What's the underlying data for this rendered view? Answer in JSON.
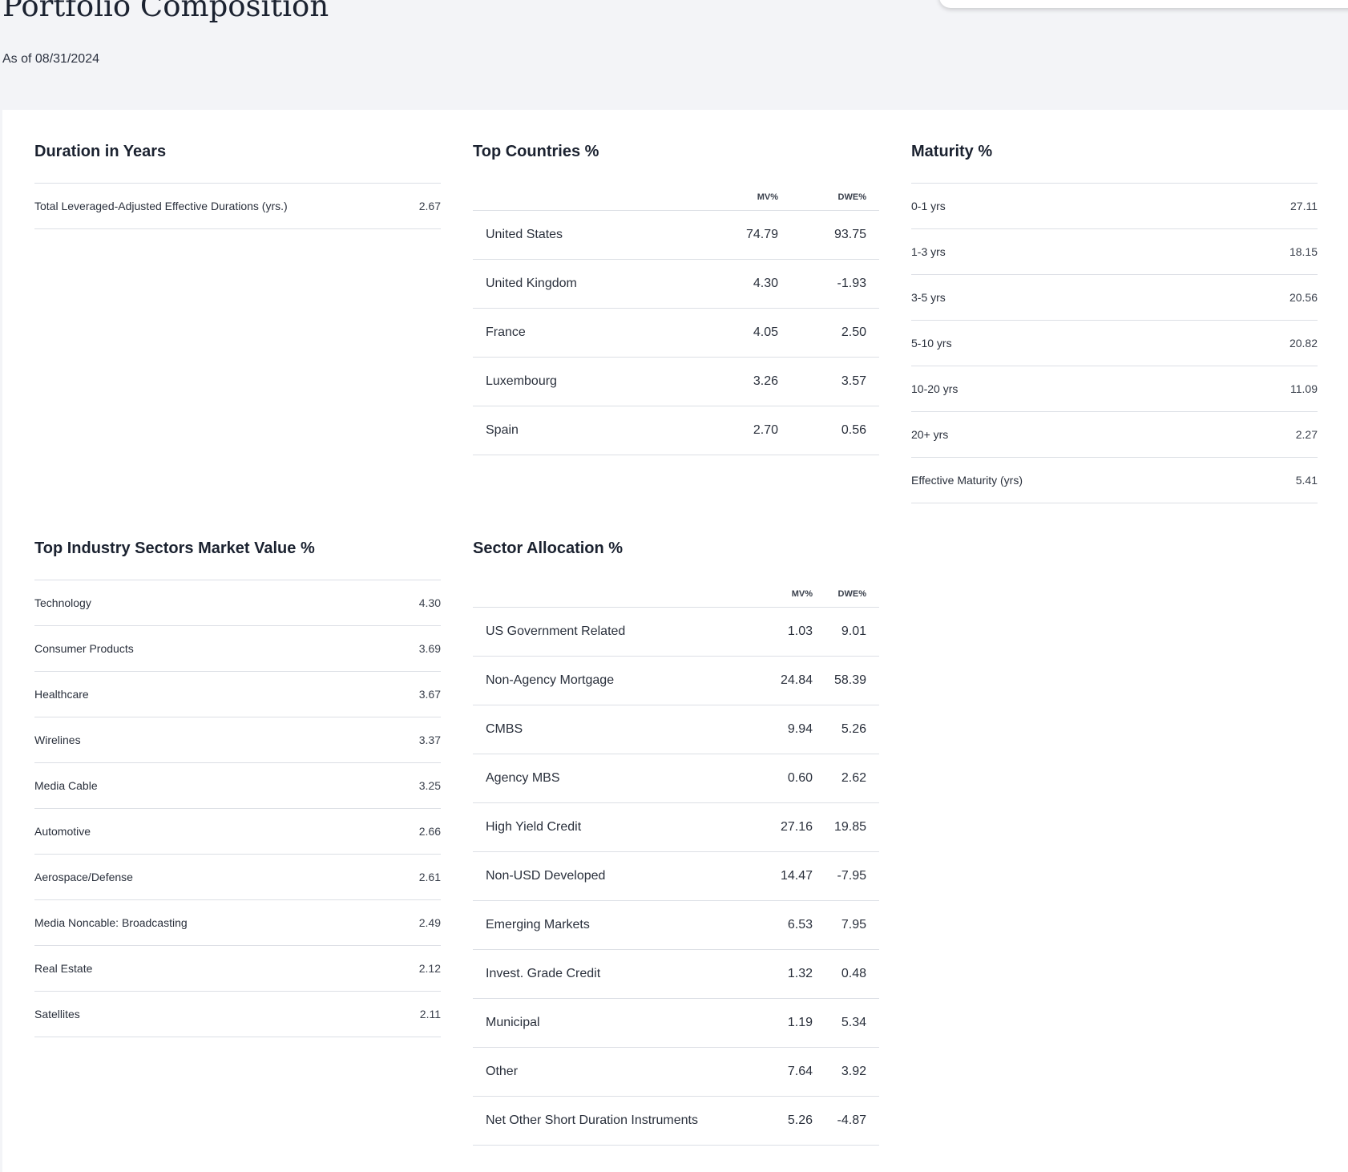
{
  "header": {
    "title": "Portfolio Composition",
    "as_of": "As of 08/31/2024"
  },
  "duration": {
    "title": "Duration in Years",
    "rows": [
      {
        "label": "Total Leveraged-Adjusted Effective Durations (yrs.)",
        "value": "2.67"
      }
    ]
  },
  "top_countries": {
    "title": "Top Countries %",
    "col_mv": "MV%",
    "col_dwe": "DWE%",
    "rows": [
      {
        "name": "United States",
        "mv": "74.79",
        "dwe": "93.75"
      },
      {
        "name": "United Kingdom",
        "mv": "4.30",
        "dwe": "-1.93"
      },
      {
        "name": "France",
        "mv": "4.05",
        "dwe": "2.50"
      },
      {
        "name": "Luxembourg",
        "mv": "3.26",
        "dwe": "3.57"
      },
      {
        "name": "Spain",
        "mv": "2.70",
        "dwe": "0.56"
      }
    ]
  },
  "maturity": {
    "title": "Maturity %",
    "rows": [
      {
        "label": "0-1 yrs",
        "value": "27.11"
      },
      {
        "label": "1-3 yrs",
        "value": "18.15"
      },
      {
        "label": "3-5 yrs",
        "value": "20.56"
      },
      {
        "label": "5-10 yrs",
        "value": "20.82"
      },
      {
        "label": "10-20 yrs",
        "value": "11.09"
      },
      {
        "label": "20+ yrs",
        "value": "2.27"
      },
      {
        "label": "Effective Maturity (yrs)",
        "value": "5.41"
      }
    ]
  },
  "industry_sectors": {
    "title": "Top Industry Sectors Market Value %",
    "rows": [
      {
        "label": "Technology",
        "value": "4.30"
      },
      {
        "label": "Consumer Products",
        "value": "3.69"
      },
      {
        "label": "Healthcare",
        "value": "3.67"
      },
      {
        "label": "Wirelines",
        "value": "3.37"
      },
      {
        "label": "Media Cable",
        "value": "3.25"
      },
      {
        "label": "Automotive",
        "value": "2.66"
      },
      {
        "label": "Aerospace/Defense",
        "value": "2.61"
      },
      {
        "label": "Media Noncable: Broadcasting",
        "value": "2.49"
      },
      {
        "label": "Real Estate",
        "value": "2.12"
      },
      {
        "label": "Satellites",
        "value": "2.11"
      }
    ]
  },
  "sector_allocation": {
    "title": "Sector Allocation %",
    "col_mv": "MV%",
    "col_dwe": "DWE%",
    "rows": [
      {
        "name": "US Government Related",
        "mv": "1.03",
        "dwe": "9.01"
      },
      {
        "name": "Non-Agency Mortgage",
        "mv": "24.84",
        "dwe": "58.39"
      },
      {
        "name": "CMBS",
        "mv": "9.94",
        "dwe": "5.26"
      },
      {
        "name": "Agency MBS",
        "mv": "0.60",
        "dwe": "2.62"
      },
      {
        "name": "High Yield Credit",
        "mv": "27.16",
        "dwe": "19.85"
      },
      {
        "name": "Non-USD Developed",
        "mv": "14.47",
        "dwe": "-7.95"
      },
      {
        "name": "Emerging Markets",
        "mv": "6.53",
        "dwe": "7.95"
      },
      {
        "name": "Invest. Grade Credit",
        "mv": "1.32",
        "dwe": "0.48"
      },
      {
        "name": "Municipal",
        "mv": "1.19",
        "dwe": "5.34"
      },
      {
        "name": "Other",
        "mv": "7.64",
        "dwe": "3.92"
      },
      {
        "name": "Net Other Short Duration Instruments",
        "mv": "5.26",
        "dwe": "-4.87"
      }
    ]
  }
}
